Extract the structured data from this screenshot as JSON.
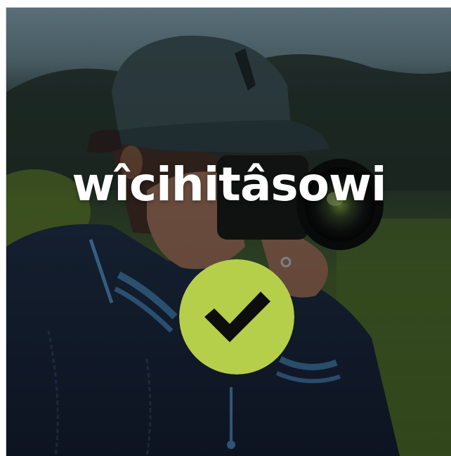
{
  "card": {
    "title": "wîcihitâsowi"
  },
  "photo": {
    "icon": "photographer-photo"
  },
  "confirm": {
    "icon": "checkmark-icon",
    "color": "#b6cf4b",
    "mark_color": "#0d0d0d"
  }
}
